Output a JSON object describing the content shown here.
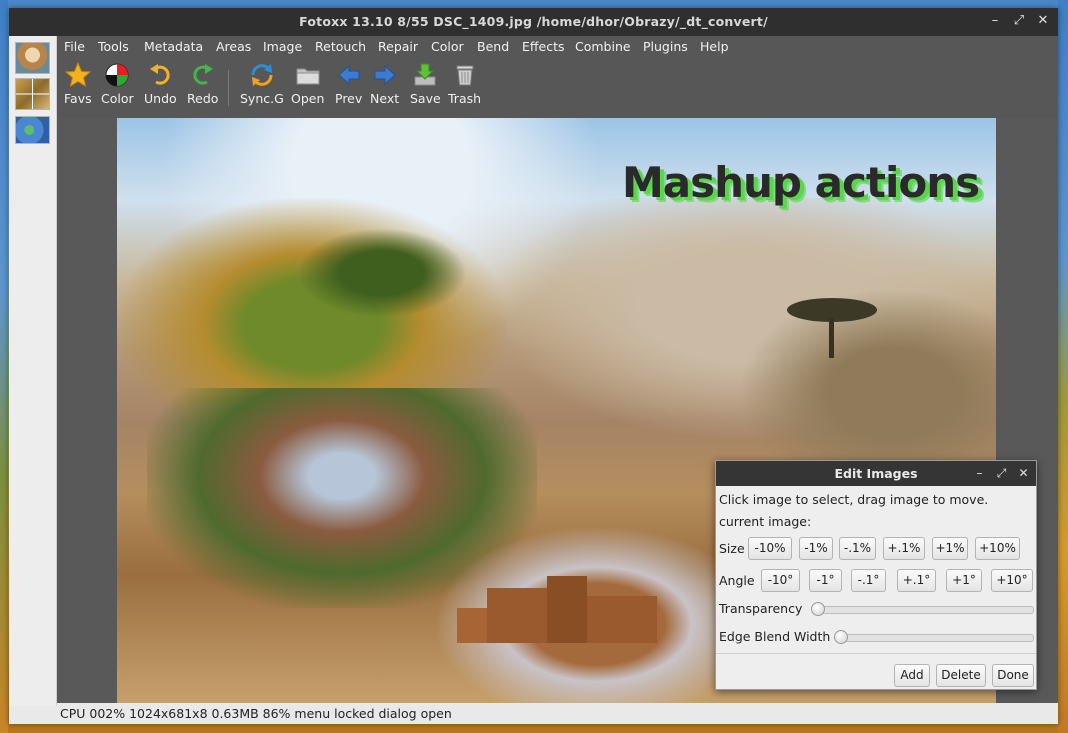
{
  "window": {
    "title": "Fotoxx 13.10  8/55  DSC_1409.jpg  /home/dhor/Obrazy/_dt_convert/",
    "controls": [
      "–",
      "⤢",
      "✕"
    ]
  },
  "menu": [
    "File",
    "Tools",
    "Metadata",
    "Areas",
    "Image",
    "Retouch",
    "Repair",
    "Color",
    "Bend",
    "Effects",
    "Combine",
    "Plugins",
    "Help"
  ],
  "toolbar": {
    "buttons": [
      "Favs",
      "Color",
      "Undo",
      "Redo",
      "Sync.G",
      "Open",
      "Prev",
      "Next",
      "Save",
      "Trash"
    ]
  },
  "image": {
    "overlay_text": "Mashup actions"
  },
  "status": "CPU 002%  1024x681x8  0.63MB  86%  menu locked  dialog open",
  "dialog": {
    "title": "Edit Images",
    "instruction": "Click image to select, drag image to move.",
    "current_label": "current image:",
    "size_label": "Size",
    "size_buttons": [
      "-10%",
      "-1%",
      "-.1%",
      "+.1%",
      "+1%",
      "+10%"
    ],
    "angle_label": "Angle",
    "angle_buttons": [
      "-10°",
      "-1°",
      "-.1°",
      "+.1°",
      "+1°",
      "+10°"
    ],
    "transparency_label": "Transparency",
    "transparency_value": 0,
    "edge_blend_label": "Edge Blend Width",
    "edge_blend_value": 0,
    "actions": [
      "Add",
      "Delete",
      "Done"
    ]
  },
  "colors": {
    "titlebar": "#2f2f2f",
    "toolbar": "#575757",
    "overlay_glow": "#59d64a"
  }
}
